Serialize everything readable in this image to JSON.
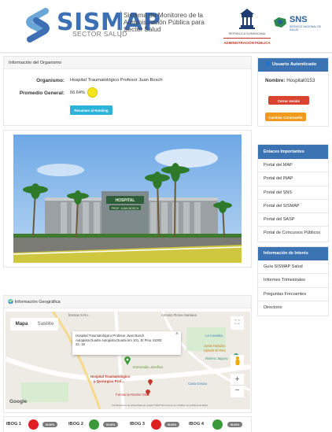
{
  "header": {
    "brand": "SISMAP",
    "brand_sub": "SECTOR SALUD",
    "brand_desc": "Sistema de Monitoreo de la Administración Pública para Sector Salud",
    "gov_text": "REPÚBLICA DOMINICANA",
    "gov_admin": "ADMINISTRACIÓN PÚBLICA",
    "sns": "SNS",
    "sns_sub": "SERVICIO NACIONAL DE SALUD"
  },
  "org": {
    "panel_title": "Información del Organismo",
    "org_label": "Organismo:",
    "org_value": "Hospital Traumatológico Profesor Juan Bosch",
    "avg_label": "Promedio General:",
    "avg_value": "66.64%",
    "avg_color": "#f5e61b",
    "button": "Resumen al Ranking"
  },
  "user": {
    "title": "Usuario Autenticado",
    "name_label": "Nombre:",
    "name_value": "Hospital0153",
    "logout": "Cerrar sesión",
    "change_password": "Cambiar Contraseña"
  },
  "links": {
    "title": "Enlaces Importantes",
    "items": [
      "Portal del MAP",
      "Portal del INAP",
      "Portal del SNS",
      "Portal del SISMAP",
      "Portal del SASP",
      "Portal de Concursos Públicos"
    ]
  },
  "info": {
    "title": "Información de Interés",
    "items": [
      "Guía SISMAP Salud",
      "Informes Trimestrales",
      "Preguntas Frecuentes",
      "Directorio"
    ]
  },
  "photo": {
    "sign": "HOSPITAL",
    "sign2": "PROF. JUAN BOSCH"
  },
  "geo": {
    "title": "Información Geográfica",
    "tab_map": "Mapa",
    "tab_sat": "Satélite",
    "popup_title": "Hospital Traumatológico Profesor Juan Bosch",
    "popup_addr": "Autopista Duarte Autopista Duarte km 101, El Pino 41000 42, 18",
    "labels": {
      "top_left": "lmenas S.R.L.",
      "top_mid": "Antonio Flores Santana",
      "la_camelia": "La Camelia",
      "junta": "Junta Helados",
      "splash": "Splash El Pino",
      "riviera": "Riviera Jaguey",
      "esmeralda": "Esmeralda Josefina",
      "hospital": "Hospital Traumatológico",
      "hospital2": "y Quirúrgico Prof...",
      "casa": "Casa Genao",
      "farmacia": "Farmacia Rachel O&B",
      "google": "Google",
      "footer": "Combinaciones de teclas   Datos de mapas ©2022   Términos de uso   Notificar un problema de Maps",
      "zoom_in": "+",
      "zoom_out": "−",
      "fullscreen": "⛶",
      "close": "×"
    }
  },
  "ibogs": [
    {
      "label": "IBOG 1",
      "color": "#e02020",
      "pill": "00.00%"
    },
    {
      "label": "IBOG 2",
      "color": "#3a9a3a",
      "pill": "00.00%"
    },
    {
      "label": "IBOG 3",
      "color": "#e02020",
      "pill": "00.00%"
    },
    {
      "label": "IBOG 4",
      "color": "#3a9a3a",
      "pill": "00.00%"
    }
  ]
}
